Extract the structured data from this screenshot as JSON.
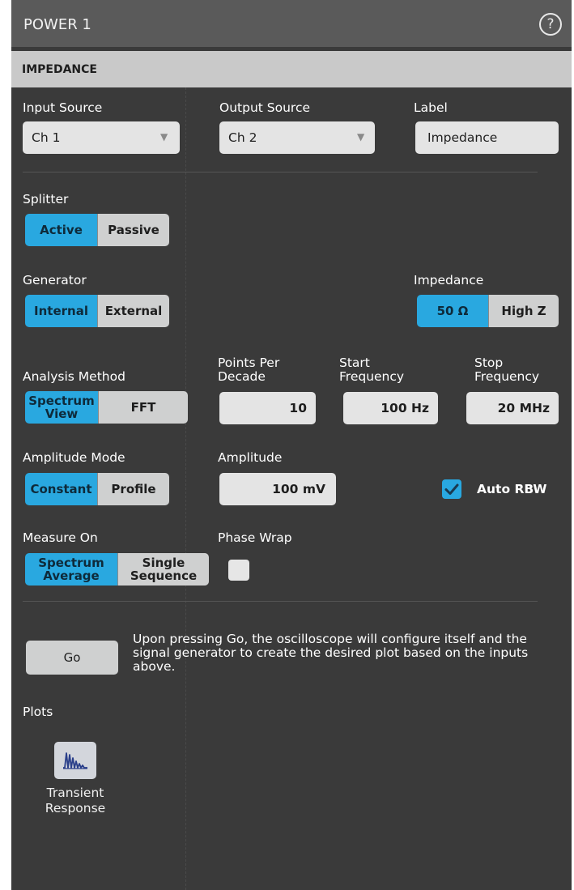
{
  "header": {
    "title": "POWER 1",
    "help_icon": "help-icon",
    "help_glyph": "?"
  },
  "section": {
    "title": "IMPEDANCE"
  },
  "input_source": {
    "label": "Input Source",
    "value": "Ch 1"
  },
  "output_source": {
    "label": "Output Source",
    "value": "Ch 2"
  },
  "label_field": {
    "label": "Label",
    "value": "Impedance"
  },
  "splitter": {
    "label": "Splitter",
    "options": [
      "Active",
      "Passive"
    ],
    "selected": "Active"
  },
  "generator": {
    "label": "Generator",
    "options": [
      "Internal",
      "External"
    ],
    "selected": "Internal"
  },
  "impedance": {
    "label": "Impedance",
    "options": [
      "50 Ω",
      "High Z"
    ],
    "selected": "50 Ω"
  },
  "analysis_method": {
    "label": "Analysis Method",
    "options": [
      "Spectrum View",
      "FFT"
    ],
    "option1_line1": "Spectrum",
    "option1_line2": "View",
    "selected": "Spectrum View"
  },
  "points_per_decade": {
    "label_line1": "Points Per",
    "label_line2": "Decade",
    "value": "10"
  },
  "start_frequency": {
    "label_line1": "Start",
    "label_line2": "Frequency",
    "value": "100 Hz"
  },
  "stop_frequency": {
    "label_line1": "Stop",
    "label_line2": "Frequency",
    "value": "20 MHz"
  },
  "amplitude_mode": {
    "label": "Amplitude Mode",
    "options": [
      "Constant",
      "Profile"
    ],
    "selected": "Constant"
  },
  "amplitude": {
    "label": "Amplitude",
    "value": "100 mV"
  },
  "auto_rbw": {
    "label": "Auto RBW",
    "checked": true
  },
  "measure_on": {
    "label": "Measure On",
    "option1_line1": "Spectrum",
    "option1_line2": "Average",
    "option2_line1": "Single",
    "option2_line2": "Sequence",
    "selected": "Spectrum Average"
  },
  "phase_wrap": {
    "label": "Phase Wrap",
    "checked": false
  },
  "go": {
    "label": "Go",
    "description": "Upon pressing Go, the oscilloscope will configure itself and the signal generator to create the desired plot based on the inputs above."
  },
  "plots": {
    "label": "Plots",
    "items": [
      {
        "icon": "transient-response-plot-icon",
        "label_line1": "Transient",
        "label_line2": "Response"
      }
    ]
  },
  "colors": {
    "panel_bg": "#3a3a3a",
    "title_bg": "#5a5a5a",
    "section_bg": "#c9c9c9",
    "selected": "#29a8e0",
    "button": "#cfd0d0",
    "field": "#e4e4e4"
  },
  "icons": {
    "dropdown": "chevron-down-icon",
    "check": "checkmark-icon"
  }
}
